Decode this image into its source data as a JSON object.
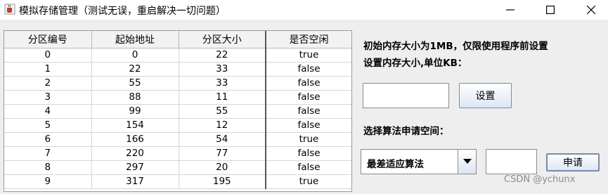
{
  "window": {
    "title": "模拟存储管理（测试无误，重启解决一切问题）",
    "icons": {
      "app": "java-coffee-icon",
      "minimize": "minimize-icon",
      "maximize": "maximize-icon",
      "close": "close-icon"
    }
  },
  "table": {
    "headers": [
      "分区编号",
      "起始地址",
      "分区大小",
      "是否空闲"
    ],
    "rows": [
      [
        "0",
        "0",
        "22",
        "true"
      ],
      [
        "1",
        "22",
        "33",
        "false"
      ],
      [
        "2",
        "55",
        "33",
        "false"
      ],
      [
        "3",
        "88",
        "11",
        "false"
      ],
      [
        "4",
        "99",
        "55",
        "false"
      ],
      [
        "5",
        "154",
        "12",
        "false"
      ],
      [
        "6",
        "166",
        "54",
        "true"
      ],
      [
        "7",
        "220",
        "77",
        "false"
      ],
      [
        "8",
        "297",
        "20",
        "false"
      ],
      [
        "9",
        "317",
        "195",
        "true"
      ]
    ]
  },
  "settings": {
    "info_line1": "初始内存大小为1MB，仅限使用程序前设置",
    "info_line2": "设置内存大小,单位KB：",
    "size_value": "",
    "set_button": "设置"
  },
  "request": {
    "algo_label": "选择算法申请空间：",
    "algo_selected": "最差适应算法",
    "size_value": "",
    "apply_button": "申请"
  },
  "watermark": "CSDN @ychunx"
}
